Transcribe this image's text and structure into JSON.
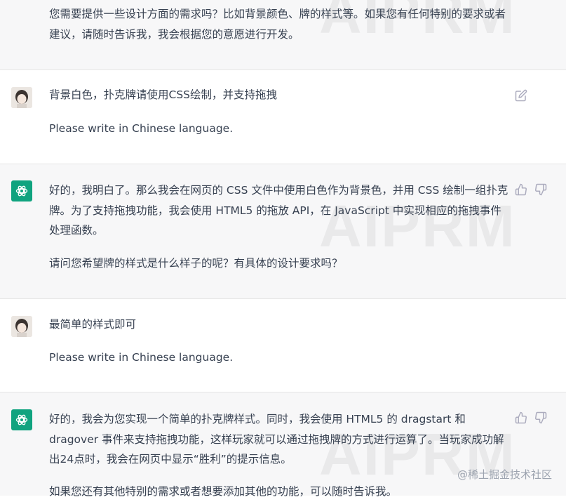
{
  "conversation": [
    {
      "role": "assistant",
      "paragraphs": [
        "您需要提供一些设计方面的需求吗？比如背景颜色、牌的样式等。如果您有任何特别的要求或者建议，请随时告诉我，我会根据您的意愿进行开发。"
      ]
    },
    {
      "role": "user",
      "paragraphs": [
        "背景白色，扑克牌请使用CSS绘制，并支持拖拽",
        "Please write in Chinese language."
      ]
    },
    {
      "role": "assistant",
      "paragraphs": [
        "好的，我明白了。那么我会在网页的 CSS 文件中使用白色作为背景色，并用 CSS 绘制一组扑克牌。为了支持拖拽功能，我会使用 HTML5 的拖放 API，在 JavaScript 中实现相应的拖拽事件处理函数。",
        "请问您希望牌的样式是什么样子的呢？有具体的设计要求吗？"
      ]
    },
    {
      "role": "user",
      "paragraphs": [
        "最简单的样式即可",
        "Please write in Chinese language."
      ]
    },
    {
      "role": "assistant",
      "paragraphs": [
        "好的，我会为您实现一个简单的扑克牌样式。同时，我会使用 HTML5 的 dragstart 和 dragover 事件来支持拖拽功能，这样玩家就可以通过拖拽牌的方式进行运算了。当玩家成功解出24点时，我会在网页中显示“胜利”的提示信息。",
        "如果您还有其他特别的需求或者想要添加其他的功能，可以随时告诉我。"
      ]
    }
  ],
  "watermark_text": "AIPRM",
  "footer_watermark": "@稀土掘金技术社区",
  "icons": {
    "edit": "edit-icon",
    "thumbs_up": "thumbs-up-icon",
    "thumbs_down": "thumbs-down-icon",
    "assistant_avatar": "openai-logo-icon",
    "user_avatar": "user-avatar"
  },
  "colors": {
    "assistant_bg": "#f7f7f8",
    "user_bg": "#ffffff",
    "brand_green": "#10a37f",
    "text": "#374151",
    "icon": "#acacbe"
  }
}
